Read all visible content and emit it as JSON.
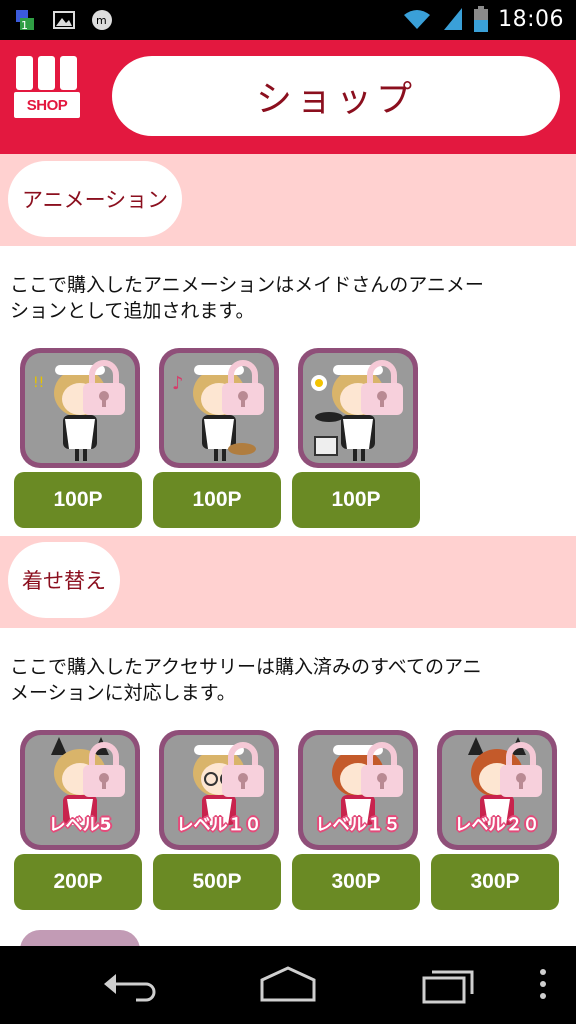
{
  "status_bar": {
    "time": "18:06",
    "icons": [
      "notification-icon",
      "image-icon",
      "messenger-icon",
      "wifi-icon",
      "signal-icon",
      "battery-icon"
    ]
  },
  "header": {
    "logo_text": "SHOP",
    "title": "ショップ"
  },
  "animation_section": {
    "label": "アニメーション",
    "description_line1": "ここで購入したアニメーションはメイドさんのアニメー",
    "description_line2": "ションとして追加されます。",
    "items": [
      {
        "price": "100P",
        "icon": "maid-exclaim-icon",
        "locked": true
      },
      {
        "price": "100P",
        "icon": "maid-music-icon",
        "locked": true
      },
      {
        "price": "100P",
        "icon": "maid-cooking-icon",
        "locked": true
      }
    ]
  },
  "dressup_section": {
    "label": "着せ替え",
    "description_line1": "ここで購入したアクセサリーは購入済みのすべてのアニ",
    "description_line2": "メーションに対応します。",
    "items": [
      {
        "level": "レベル5",
        "price": "200P",
        "locked": true
      },
      {
        "level": "レベル１０",
        "price": "500P",
        "locked": true
      },
      {
        "level": "レベル１５",
        "price": "300P",
        "locked": true
      },
      {
        "level": "レベル２０",
        "price": "300P",
        "locked": true
      }
    ]
  },
  "nav_bar": {
    "buttons": [
      "back-icon",
      "home-icon",
      "recent-apps-icon",
      "menu-icon"
    ]
  },
  "colors": {
    "header": "#e3183f",
    "section_band": "#ffd1d0",
    "price_button": "#6a8a24",
    "title_text": "#8b0f1e"
  }
}
